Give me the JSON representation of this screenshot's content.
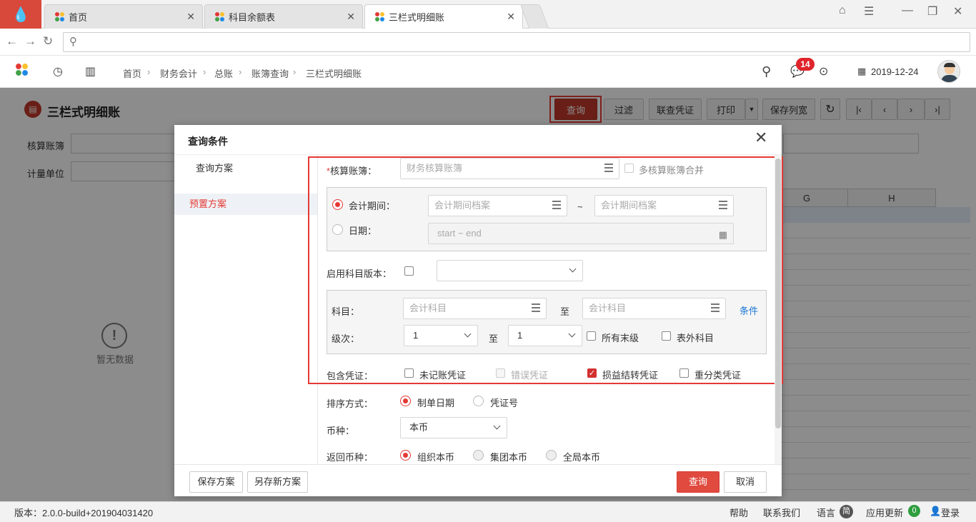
{
  "browser": {
    "tabs": [
      {
        "label": "首页"
      },
      {
        "label": "科目余额表"
      },
      {
        "label": "三栏式明细账"
      }
    ]
  },
  "header": {
    "breadcrumb": [
      "首页",
      "财务会计",
      "总账",
      "账簿查询",
      "三栏式明细账"
    ],
    "message_count": "14",
    "date": "2019-12-24"
  },
  "page": {
    "title": "三栏式明细账",
    "toolbar": {
      "query": "查询",
      "filter": "过滤",
      "linked_voucher": "联查凭证",
      "print": "打印",
      "save_col_width": "保存列宽"
    },
    "filters": {
      "ledger_label": "核算账簿",
      "unit_label": "计量单位"
    },
    "grid": {
      "columns": [
        "G",
        "H"
      ]
    },
    "empty_text": "暂无数据"
  },
  "dialog": {
    "title": "查询条件",
    "sidebar": {
      "heading": "查询方案",
      "items": [
        "预置方案"
      ]
    },
    "form": {
      "ledger_label": "核算账簿：",
      "ledger_placeholder": "财务核算账簿",
      "multi_merge_label": "多核算账簿合并",
      "period_label": "会计期间：",
      "period_placeholder": "会计期间档案",
      "tilde": "~",
      "date_label": "日期：",
      "date_placeholder": "start ~ end",
      "enable_version_label": "启用科目版本：",
      "subject_label": "科目：",
      "subject_placeholder": "会计科目",
      "to": "至",
      "condition_link": "条件",
      "level_label": "级次：",
      "level_from": "1",
      "level_to": "1",
      "all_leaf_label": "所有末级",
      "off_sheet_label": "表外科目",
      "include_label": "包含凭证：",
      "unposted_label": "未记账凭证",
      "error_label": "错误凭证",
      "pl_carry_label": "损益结转凭证",
      "reclass_label": "重分类凭证",
      "sort_label": "排序方式：",
      "sort_date_label": "制单日期",
      "sort_no_label": "凭证号",
      "currency_label": "币种：",
      "currency_value": "本币",
      "return_label": "返回币种：",
      "return_org": "组织本币",
      "return_group": "集团本币",
      "return_global": "全局本币"
    },
    "footer": {
      "save_scheme": "保存方案",
      "save_as_scheme": "另存新方案",
      "query": "查询",
      "cancel": "取消"
    }
  },
  "status_bar": {
    "version": "版本：2.0.0-build+201904031420",
    "help": "帮助",
    "contact": "联系我们",
    "language": "语言",
    "language_badge": "简",
    "update": "应用更新",
    "update_count": "0",
    "login": "登录"
  },
  "colors": {
    "accent": "#e53935",
    "primary_button": "#c0392b",
    "link": "#1976d2"
  }
}
